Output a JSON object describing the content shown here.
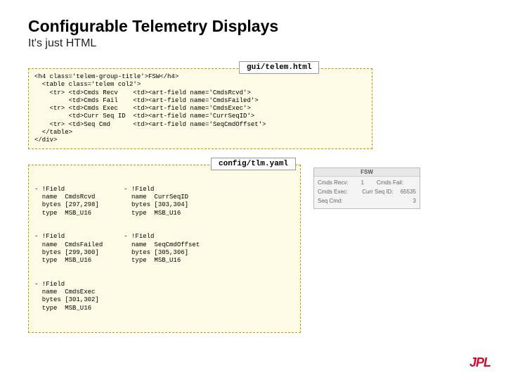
{
  "title": "Configurable Telemetry Displays",
  "subtitle": "It's just HTML",
  "file1_label": "gui/telem.html",
  "file2_label": "config/tlm.yaml",
  "code_html": "<h4 class='telem-group-title'>FSW</h4>\n  <table class='telem col2'>\n    <tr> <td>Cmds Recv    <td><art-field name='CmdsRcvd'>\n         <td>Cmds Fail    <td><art-field name='CmdsFailed'>\n    <tr> <td>Cmds Exec    <td><art-field name='CmdsExec'>\n         <td>Curr Seq ID  <td><art-field name='CurrSeqID'>\n    <tr> <td>Seq Cmd      <td><art-field name='SeqCmdOffset'>\n  </table>\n</div>",
  "yaml_col1": "- !Field\n  name  CmdsRcvd\n  bytes [297,298]\n  type  MSB_U16\n\n\n- !Field\n  name  CmdsFailed\n  bytes [299,300]\n  type  MSB_U16\n\n\n- !Field\n  name  CmdsExec\n  bytes [301,302]\n  type  MSB_U16",
  "yaml_col2": "- !Field\n  name  CurrSeqID\n  bytes [303,304]\n  type  MSB_U16\n\n\n- !Field\n  name  SeqCmdOffset\n  bytes [305,306]\n  type  MSB_U16",
  "preview": {
    "title": "FSW",
    "rows": [
      {
        "l1": "Cmds Recv:",
        "v1": "1",
        "l2": "Cmds Fail:",
        "v2": ""
      },
      {
        "l1": "Cmds Exec:",
        "v1": "",
        "l2": "Curr Seq ID:",
        "v2": "65535"
      },
      {
        "l1": "Seq Cmd:",
        "v1": "3",
        "l2": "",
        "v2": ""
      }
    ]
  },
  "logo": "JPL"
}
